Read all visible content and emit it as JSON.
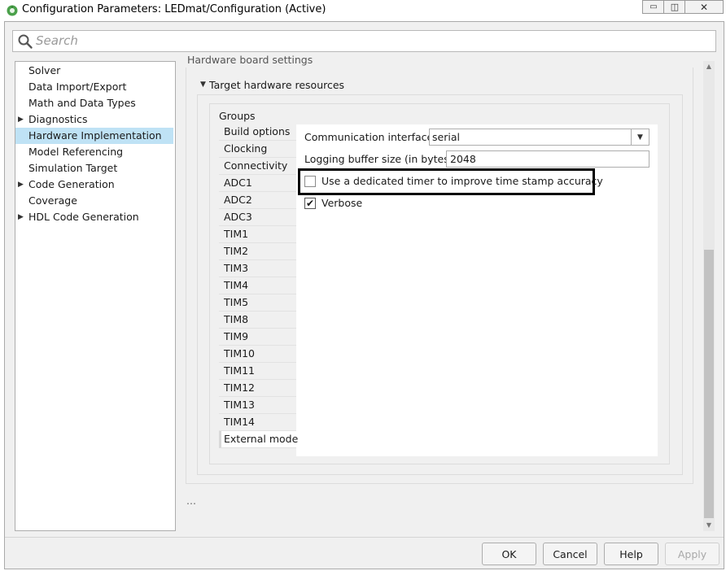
{
  "window": {
    "title": "Configuration Parameters: LEDmat/Configuration (Active)",
    "min_glyph": "▭",
    "max_glyph": "◫",
    "close_glyph": "✕"
  },
  "search": {
    "placeholder": "Search"
  },
  "tree": {
    "items": [
      {
        "label": "Solver",
        "expandable": false
      },
      {
        "label": "Data Import/Export",
        "expandable": false
      },
      {
        "label": "Math and Data Types",
        "expandable": false
      },
      {
        "label": "Diagnostics",
        "expandable": true
      },
      {
        "label": "Hardware Implementation",
        "expandable": false,
        "selected": true
      },
      {
        "label": "Model Referencing",
        "expandable": false
      },
      {
        "label": "Simulation Target",
        "expandable": false
      },
      {
        "label": "Code Generation",
        "expandable": true
      },
      {
        "label": "Coverage",
        "expandable": false
      },
      {
        "label": "HDL Code Generation",
        "expandable": true
      }
    ],
    "arrow_glyph": "▶"
  },
  "content": {
    "section_header": "Hardware board settings",
    "target_hw_label": "Target hardware resources",
    "target_hw_arrow": "▼",
    "groups_label": "Groups",
    "group_tabs": [
      "Build options",
      "Clocking",
      "Connectivity",
      "ADC1",
      "ADC2",
      "ADC3",
      "TIM1",
      "TIM2",
      "TIM3",
      "TIM4",
      "TIM5",
      "TIM8",
      "TIM9",
      "TIM10",
      "TIM11",
      "TIM12",
      "TIM13",
      "TIM14",
      "External mode"
    ],
    "active_group": "External mode",
    "comm_interface_label": "Communication interface:",
    "comm_interface_value": "serial",
    "select_arrow": "▼",
    "logging_buffer_label": "Logging buffer size (in bytes):",
    "logging_buffer_value": "2048",
    "timer_checkbox_label": "Use a dedicated timer to improve time stamp accuracy",
    "timer_checked": false,
    "verbose_label": "Verbose",
    "verbose_checked": true,
    "check_glyph": "✔",
    "ellipsis": "..."
  },
  "buttons": {
    "ok": "OK",
    "cancel": "Cancel",
    "help": "Help",
    "apply": "Apply"
  },
  "scroll_arrows": {
    "up": "▲",
    "down": "▼"
  },
  "colors": {
    "selection": "#bfe2f5",
    "highlight_border": "#000000"
  }
}
